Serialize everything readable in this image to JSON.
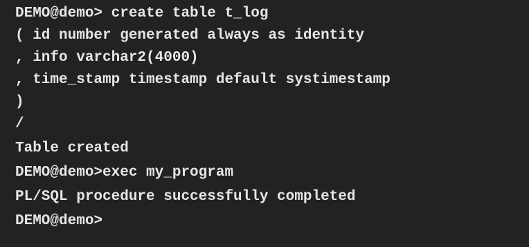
{
  "terminal": {
    "background": "#222222",
    "foreground": "#e6e6e6",
    "lines": [
      "DEMO@demo> create table t_log",
      "( id number generated always as identity",
      ", info varchar2(4000)",
      ", time_stamp timestamp default systimestamp",
      ")",
      "/",
      "Table created",
      "DEMO@demo>exec my_program",
      "PL/SQL procedure successfully completed",
      "DEMO@demo>"
    ]
  }
}
